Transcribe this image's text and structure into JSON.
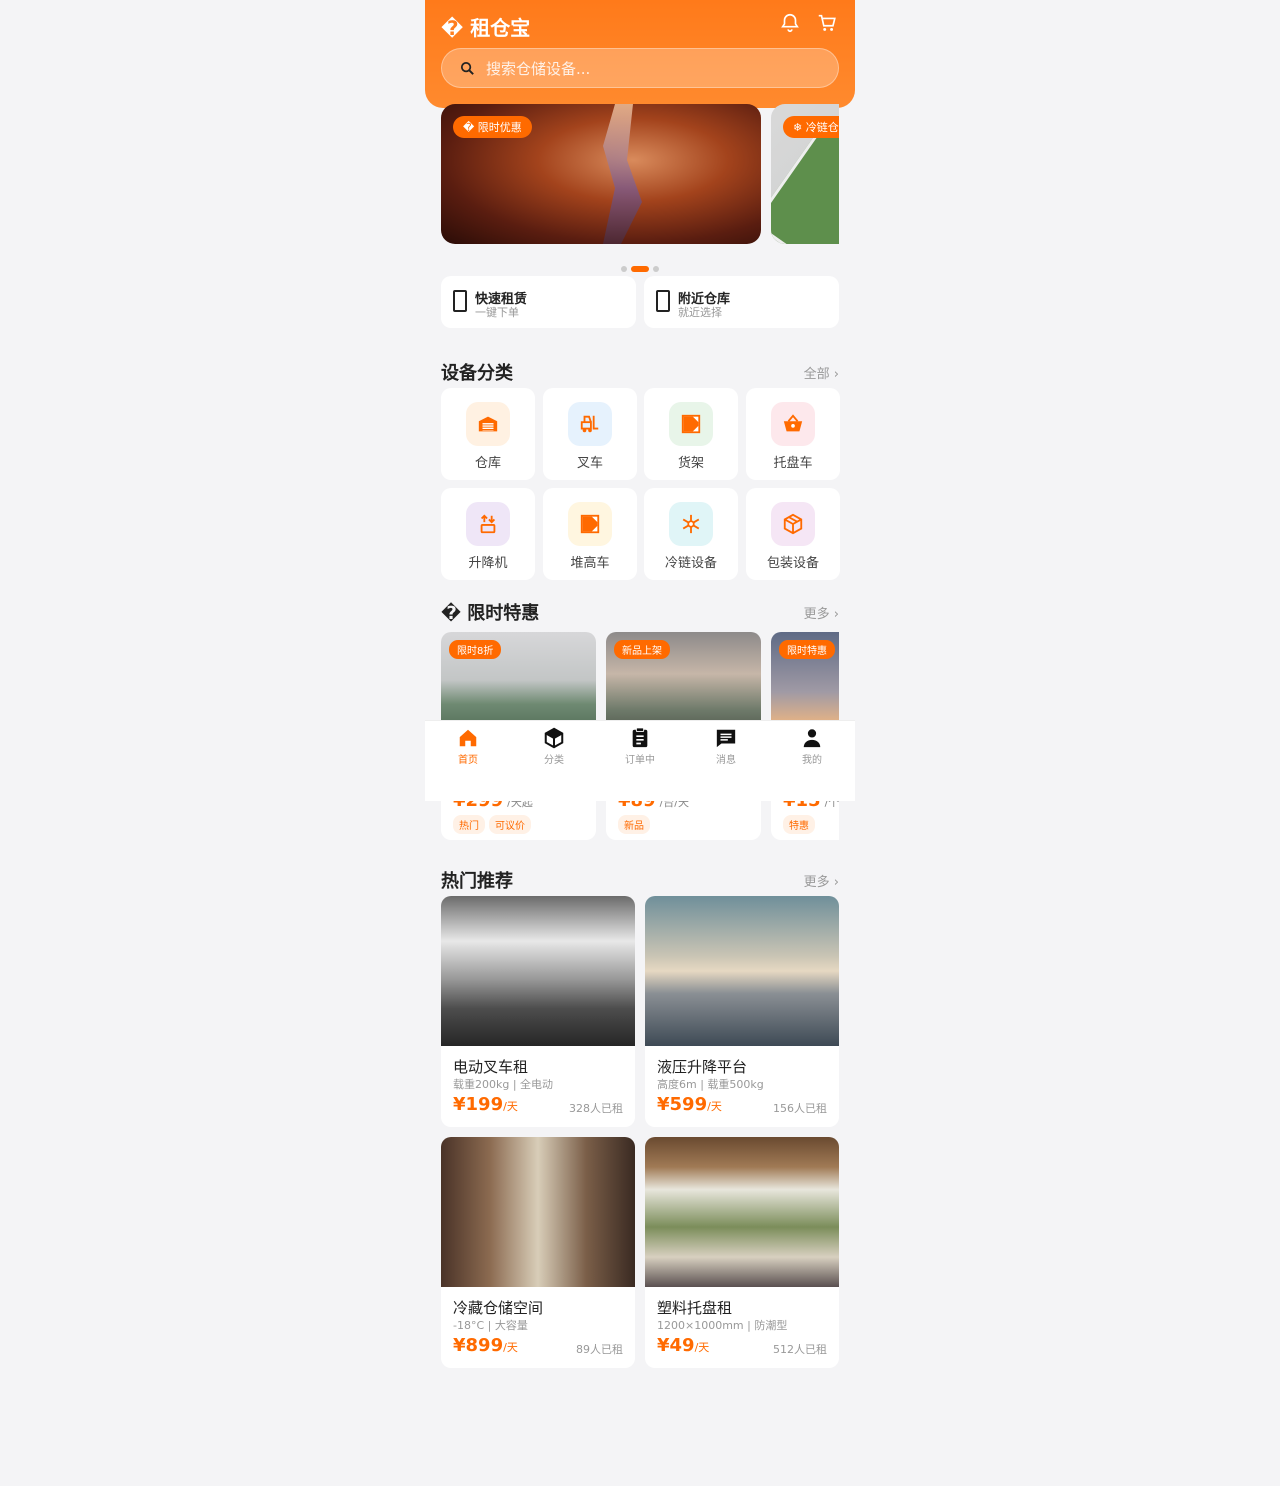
{
  "header": {
    "brand": "� 租仓宝",
    "search_placeholder": "搜索仓储设备..."
  },
  "banners": [
    {
      "tag": "� 限时优惠"
    },
    {
      "tag": "❄ 冷链仓"
    }
  ],
  "carousel": {
    "count": 3,
    "active_index": 1
  },
  "quick": [
    {
      "title": "快速租赁",
      "subtitle": "一键下单"
    },
    {
      "title": "附近仓库",
      "subtitle": "就近选择"
    }
  ],
  "categories": {
    "title": "设备分类",
    "more": "全部 ›",
    "items": [
      {
        "label": "仓库",
        "icon": "warehouse-icon"
      },
      {
        "label": "叉车",
        "icon": "forklift-icon"
      },
      {
        "label": "货架",
        "icon": "shelf-icon"
      },
      {
        "label": "托盘车",
        "icon": "basket-icon"
      },
      {
        "label": "升降机",
        "icon": "lift-icon"
      },
      {
        "label": "堆高车",
        "icon": "stacker-icon"
      },
      {
        "label": "冷链设备",
        "icon": "snowflake-icon"
      },
      {
        "label": "包装设备",
        "icon": "package-icon"
      }
    ]
  },
  "deals": {
    "title": "� 限时特惠",
    "more": "更多 ›",
    "items": [
      {
        "tag": "限时8折",
        "price": "¥299",
        "unit": "/天起",
        "chips": [
          "热门",
          "可议价"
        ]
      },
      {
        "tag": "新品上架",
        "price": "¥89",
        "unit": "/台/天",
        "chips": [
          "新品"
        ]
      },
      {
        "tag": "限时特惠",
        "price": "¥15",
        "unit": "/个/天",
        "chips": [
          "特惠"
        ]
      }
    ]
  },
  "tabbar": {
    "active_index": 0,
    "items": [
      {
        "label": "首页",
        "icon": "home-icon"
      },
      {
        "label": "分类",
        "icon": "cube-icon"
      },
      {
        "label": "订单中",
        "icon": "clipboard-icon"
      },
      {
        "label": "消息",
        "icon": "chat-icon"
      },
      {
        "label": "我的",
        "icon": "user-icon"
      }
    ]
  },
  "products": {
    "title": "热门推荐",
    "more": "更多 ›",
    "items": [
      {
        "name": "电动叉车租",
        "spec": "载重200kg | 全电动",
        "price": "¥199",
        "unit": "/天",
        "rented": "328人已租"
      },
      {
        "name": "液压升降平台",
        "spec": "高度6m | 载重500kg",
        "price": "¥599",
        "unit": "/天",
        "rented": "156人已租"
      },
      {
        "name": "冷藏仓储空间",
        "spec": "-18°C | 大容量",
        "price": "¥899",
        "unit": "/天",
        "rented": "89人已租"
      },
      {
        "name": "塑料托盘租",
        "spec": "1200×1000mm | 防潮型",
        "price": "¥49",
        "unit": "/天",
        "rented": "512人已租"
      }
    ]
  },
  "colors": {
    "accent": "#ff6a00",
    "background": "#f4f4f6"
  }
}
